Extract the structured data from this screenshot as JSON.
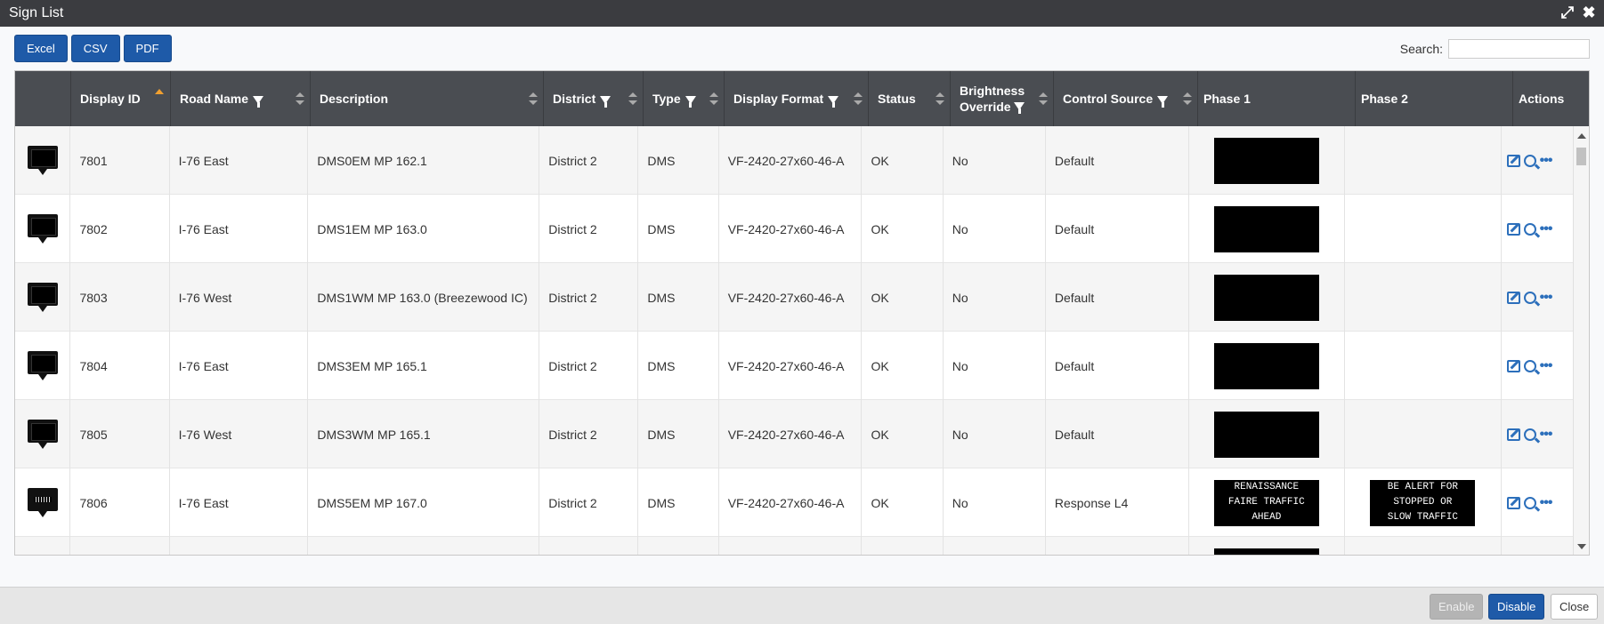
{
  "window": {
    "title": "Sign List"
  },
  "toolbar": {
    "excel": "Excel",
    "csv": "CSV",
    "pdf": "PDF"
  },
  "search": {
    "label": "Search:",
    "value": ""
  },
  "columns": [
    "",
    "Display ID",
    "Road Name",
    "Description",
    "District",
    "Type",
    "Display Format",
    "Status",
    "Brightness Override",
    "Control Source",
    "Phase 1",
    "Phase 2",
    "Actions"
  ],
  "sort": {
    "column": "Display ID",
    "direction": "ascending"
  },
  "rows": [
    {
      "icon": "dms-blank-icon",
      "id": "7801",
      "road": "I-76 East",
      "description": "DMS0EM MP 162.1",
      "district": "District 2",
      "type": "DMS",
      "format": "VF-2420-27x60-46-A",
      "status": "OK",
      "brightness": "No",
      "control": "Default",
      "phase1": [],
      "phase2": []
    },
    {
      "icon": "dms-blank-icon",
      "id": "7802",
      "road": "I-76 East",
      "description": "DMS1EM MP 163.0",
      "district": "District 2",
      "type": "DMS",
      "format": "VF-2420-27x60-46-A",
      "status": "OK",
      "brightness": "No",
      "control": "Default",
      "phase1": [],
      "phase2": []
    },
    {
      "icon": "dms-blank-icon",
      "id": "7803",
      "road": "I-76 West",
      "description": "DMS1WM MP 163.0 (Breezewood IC)",
      "district": "District 2",
      "type": "DMS",
      "format": "VF-2420-27x60-46-A",
      "status": "OK",
      "brightness": "No",
      "control": "Default",
      "phase1": [],
      "phase2": []
    },
    {
      "icon": "dms-blank-icon",
      "id": "7804",
      "road": "I-76 East",
      "description": "DMS3EM MP 165.1",
      "district": "District 2",
      "type": "DMS",
      "format": "VF-2420-27x60-46-A",
      "status": "OK",
      "brightness": "No",
      "control": "Default",
      "phase1": [],
      "phase2": []
    },
    {
      "icon": "dms-blank-icon",
      "id": "7805",
      "road": "I-76 West",
      "description": "DMS3WM MP 165.1",
      "district": "District 2",
      "type": "DMS",
      "format": "VF-2420-27x60-46-A",
      "status": "OK",
      "brightness": "No",
      "control": "Default",
      "phase1": [],
      "phase2": []
    },
    {
      "icon": "dms-message-icon",
      "id": "7806",
      "road": "I-76 East",
      "description": "DMS5EM MP 167.0",
      "district": "District 2",
      "type": "DMS",
      "format": "VF-2420-27x60-46-A",
      "status": "OK",
      "brightness": "No",
      "control": "Response L4",
      "phase1": [
        "RENAISSANCE",
        "FAIRE TRAFFIC",
        "AHEAD"
      ],
      "phase2": [
        "BE ALERT FOR",
        "STOPPED OR",
        "SLOW TRAFFIC"
      ]
    },
    {
      "icon": "dms-blank-icon",
      "id": "",
      "road": "",
      "description": "",
      "district": "",
      "type": "",
      "format": "",
      "status": "",
      "brightness": "",
      "control": "",
      "phase1": [],
      "phase2": []
    }
  ],
  "footer": {
    "enable": "Enable",
    "disable": "Disable",
    "close": "Close"
  },
  "colors": {
    "header": "#4a4d52",
    "titlebar": "#3b3c40",
    "primary": "#1e5aa8",
    "sort_active": "#f0a030",
    "action_icon": "#2c6fbb"
  }
}
